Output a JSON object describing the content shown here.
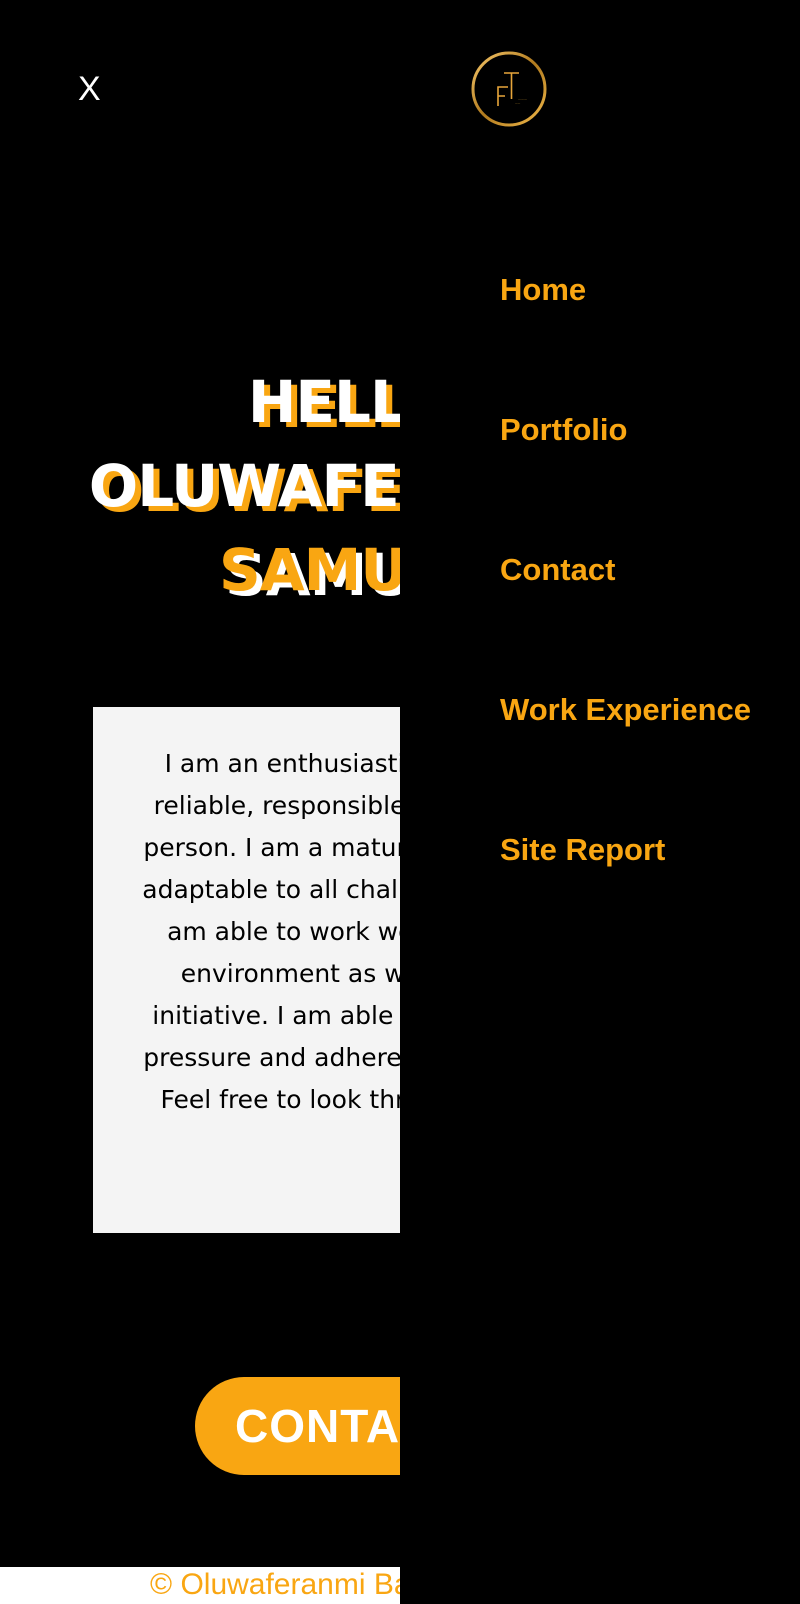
{
  "header": {
    "close_label": "X",
    "logo_icon": "ft-monogram-logo"
  },
  "hero": {
    "line1": "HELLO",
    "line2": "OLUWAFERANMI",
    "line3": "SAMUEL"
  },
  "about": {
    "text": "I am an enthusiastic, self-motivated, reliable, responsible and hard working person. I am a mature team worker and adaptable to all challenging situations. I am able to work well both in a team environment as well as using own initiative. I am able to work well under pressure and adhere to strict deadlines. Feel free to look through my Portfolio"
  },
  "cta": {
    "label": "CONTACT ME"
  },
  "footer": {
    "text": "© Oluwaferanmi Balogun"
  },
  "nav": {
    "items": [
      {
        "label": "Home"
      },
      {
        "label": "Portfolio"
      },
      {
        "label": "Contact"
      },
      {
        "label": "Work Experience"
      },
      {
        "label": "Site Report"
      }
    ]
  },
  "colors": {
    "accent": "#f9a612",
    "background": "#000000",
    "card": "#f4f4f4",
    "text_light": "#ffffff"
  }
}
